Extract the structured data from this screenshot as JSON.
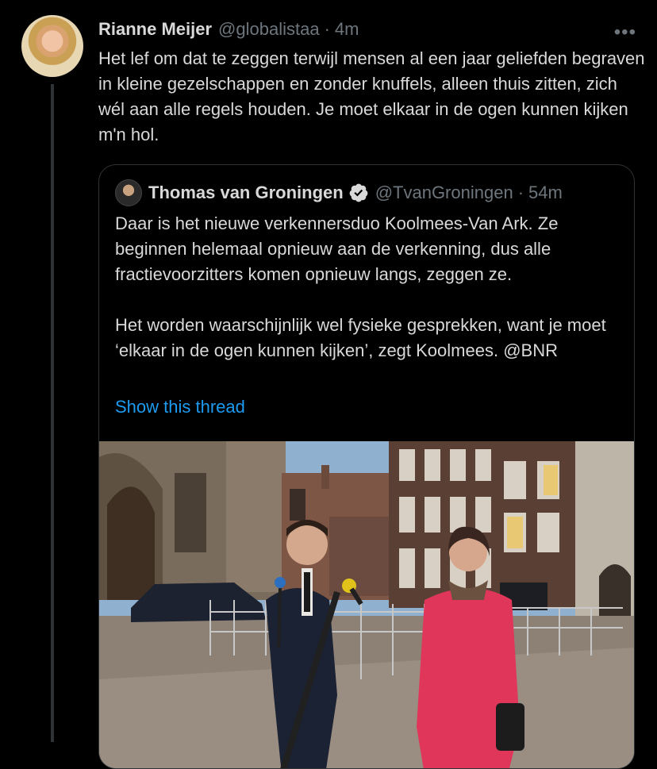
{
  "tweet": {
    "author_name": "Rianne Meijer",
    "author_handle": "@globalistaa",
    "separator": "·",
    "time": "4m",
    "more_icon": "more-horizontal-icon",
    "text": "Het lef om dat te zeggen terwijl mensen al een jaar geliefden begraven in kleine gezelschappen en zonder knuffels, alleen thuis zitten, zich wél aan alle regels houden. Je moet elkaar in de ogen kunnen kijken m'n hol."
  },
  "quote": {
    "author_name": "Thomas van Groningen",
    "verified_icon": "verified-badge-icon",
    "author_handle": "@TvanGroningen",
    "separator": "·",
    "time": "54m",
    "text": "Daar is het nieuwe verkennersduo Koolmees-Van Ark. Ze beginnen helemaal opnieuw aan de verkenning, dus alle fractievoorzitters komen opnieuw langs, zeggen ze.\n\nHet worden waarschijnlijk wel fysieke gesprekken, want je moet ‘elkaar in de ogen kunnen kijken’, zegt Koolmees. @BNR",
    "show_thread": "Show this thread"
  },
  "colors": {
    "background": "#000000",
    "text": "#d9d9d9",
    "muted": "#6e767d",
    "link": "#1d9bf0",
    "border": "#2f3336"
  }
}
